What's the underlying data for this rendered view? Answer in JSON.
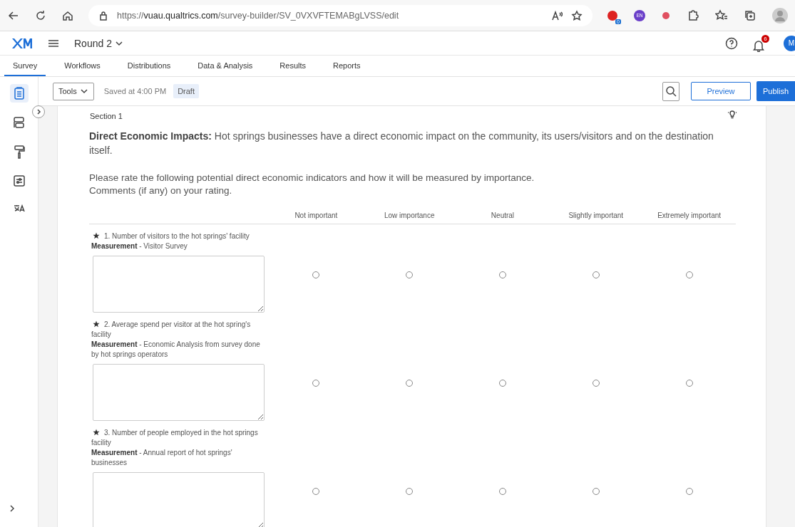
{
  "browser": {
    "url": "https://**vuau.qualtrics.com**/survey-builder/SV_0VXVFTEMABgLVSS/edit",
    "extension_badge": "0",
    "language_extension": "EN"
  },
  "app": {
    "project": "Round 2",
    "notification_count": "6",
    "avatar": "M"
  },
  "tabs": [
    {
      "label": "Survey",
      "selected": true
    },
    {
      "label": "Workflows",
      "selected": false
    },
    {
      "label": "Distributions",
      "selected": false
    },
    {
      "label": "Data & Analysis",
      "selected": false
    },
    {
      "label": "Results",
      "selected": false
    },
    {
      "label": "Reports",
      "selected": false
    }
  ],
  "sidebar": {
    "items": [
      {
        "kind": "survey",
        "selected": true
      },
      {
        "kind": "flow",
        "selected": false
      },
      {
        "kind": "look",
        "selected": false
      },
      {
        "kind": "options",
        "selected": false
      },
      {
        "kind": "translate",
        "selected": false
      }
    ]
  },
  "toolbar": {
    "tools": "Tools",
    "saved": "Saved at 4:00 PM",
    "status": "Draft",
    "preview": "Preview",
    "publish": "Publish"
  },
  "section": {
    "title": "Section 1",
    "intro": "**Direct Economic Impacts:** Hot springs businesses have a direct economic impact on the community, its users/visitors and on the destination itself.",
    "instructions": [
      "Please rate the following potential direct economic indicators and how it will be measured by importance.",
      "Comments (if any) on your rating."
    ]
  },
  "matrix": {
    "columns": [
      "Not important",
      "Low importance",
      "Neutral",
      "Slightly important",
      "Extremely important"
    ],
    "rows": [
      {
        "question": "1. Number of visitors to the hot springs' facility",
        "measurement": "**Measurement** -  Visitor Survey",
        "choices": [
          {
            "selected": false
          },
          {
            "selected": false
          },
          {
            "selected": false
          },
          {
            "selected": false
          },
          {
            "selected": false
          }
        ]
      },
      {
        "question": "2. Average spend per visitor at the hot spring's facility",
        "measurement": "**Measurement** - Economic Analysis from survey done by hot springs operators",
        "choices": [
          {
            "selected": false
          },
          {
            "selected": false
          },
          {
            "selected": false
          },
          {
            "selected": false
          },
          {
            "selected": false
          }
        ]
      },
      {
        "question": "3. Number of people employed in the hot springs facility",
        "measurement": "**Measurement** - Annual report of hot springs' businesses",
        "choices": [
          {
            "selected": false
          },
          {
            "selected": false
          },
          {
            "selected": false
          },
          {
            "selected": false
          },
          {
            "selected": false
          }
        ]
      }
    ]
  }
}
